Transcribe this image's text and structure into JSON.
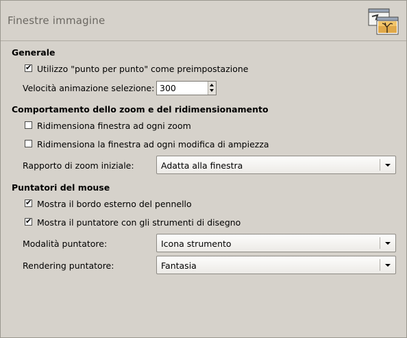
{
  "header": {
    "title": "Finestre immagine",
    "icon": "image-windows-icon"
  },
  "general": {
    "section_title": "Generale",
    "dot_for_dot": {
      "label": "Utilizzo \"punto per punto\" come preimpostazione",
      "checked": true
    },
    "anim_speed": {
      "label": "Velocità animazione selezione:",
      "value": "300"
    }
  },
  "zoom": {
    "section_title": "Comportamento dello zoom e del ridimensionamento",
    "resize_on_zoom": {
      "label": "Ridimensiona finestra ad ogni zoom",
      "checked": false
    },
    "resize_on_size": {
      "label": "Ridimensiona la finestra ad ogni modifica di ampiezza",
      "checked": false
    },
    "initial_zoom": {
      "label": "Rapporto di zoom iniziale:",
      "value": "Adatta alla finestra"
    }
  },
  "pointers": {
    "section_title": "Puntatori del mouse",
    "brush_outline": {
      "label": "Mostra il bordo esterno del pennello",
      "checked": true
    },
    "paint_tool_pointer": {
      "label": "Mostra il puntatore con gli strumenti di disegno",
      "checked": true
    },
    "pointer_mode": {
      "label": "Modalità puntatore:",
      "value": "Icona strumento"
    },
    "pointer_render": {
      "label": "Rendering puntatore:",
      "value": "Fantasia"
    }
  },
  "check_glyph": "✔"
}
